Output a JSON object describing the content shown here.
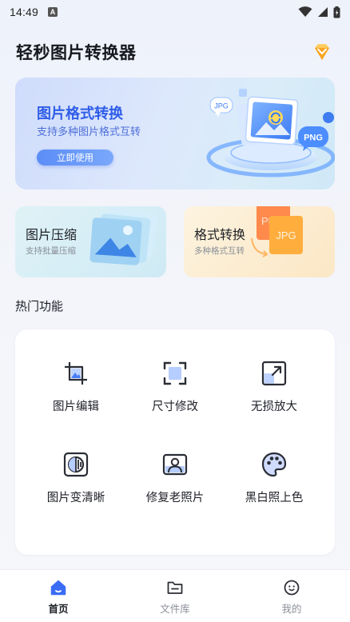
{
  "status_bar": {
    "time": "14:49",
    "a_badge": "A"
  },
  "app": {
    "title": "轻秒图片转换器",
    "vip_icon": "diamond-icon"
  },
  "hero": {
    "title": "图片格式转换",
    "subtitle": "支持多种图片格式互转",
    "button": "立即使用",
    "badges": {
      "left": "JPG",
      "right": "PNG"
    }
  },
  "cards": [
    {
      "title": "图片压缩",
      "subtitle": "支持批量压缩"
    },
    {
      "title": "格式转换",
      "subtitle": "多种格式互转",
      "art_labels": [
        "PN",
        "JPG"
      ]
    }
  ],
  "section": {
    "title": "热门功能"
  },
  "tools": [
    {
      "label": "图片编辑",
      "icon": "crop-icon"
    },
    {
      "label": "尺寸修改",
      "icon": "resize-frame-icon"
    },
    {
      "label": "无损放大",
      "icon": "expand-icon"
    },
    {
      "label": "图片变清晰",
      "icon": "sharpen-icon"
    },
    {
      "label": "修复老照片",
      "icon": "portrait-icon"
    },
    {
      "label": "黑白照上色",
      "icon": "palette-icon"
    }
  ],
  "nav": [
    {
      "label": "首页",
      "icon": "home-icon",
      "active": true
    },
    {
      "label": "文件库",
      "icon": "folder-icon",
      "active": false
    },
    {
      "label": "我的",
      "icon": "profile-icon",
      "active": false
    }
  ],
  "colors": {
    "accent": "#2f5de8",
    "nav_active_icon": "#3b6cf6"
  }
}
